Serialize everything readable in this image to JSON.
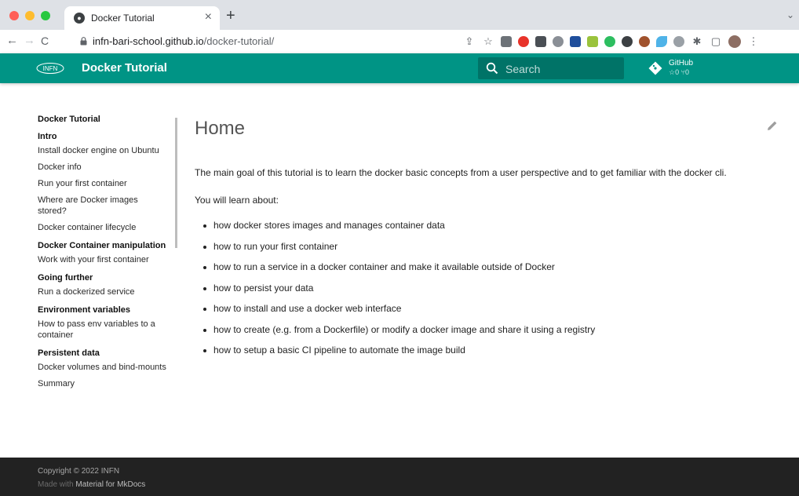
{
  "browser": {
    "tab_title": "Docker Tutorial",
    "tab_close": "×",
    "new_tab": "+",
    "tabs_menu": "⌄",
    "nav": {
      "back": "←",
      "forward": "→",
      "reload": "C"
    },
    "url_host": "infn-bari-school.github.io",
    "url_path": "/docker-tutorial/",
    "toolbar_icons": [
      "share-icon",
      "bookmark-star-icon",
      "extension-icons",
      "puzzle-icon",
      "sidebar-icon",
      "profile-avatar",
      "menu-icon"
    ],
    "toolbar_glyphs": {
      "share": "⇪",
      "star": "☆",
      "puzzle": "✱",
      "sidebar": "▢",
      "menu": "⋮"
    }
  },
  "header": {
    "title": "Docker Tutorial",
    "logo_text": "INFN",
    "search_placeholder": "Search",
    "repo_name": "GitHub",
    "repo_facts": "☆0 ⑂0",
    "accent_color": "#009485"
  },
  "sidebar": {
    "title": "Docker Tutorial",
    "sections": [
      {
        "label": "Intro",
        "items": [
          "Install docker engine on Ubuntu",
          "Docker info",
          "Run your first container",
          "Where are Docker images stored?",
          "Docker container lifecycle"
        ]
      },
      {
        "label": "Docker Container manipulation",
        "items": [
          "Work with your first container"
        ]
      },
      {
        "label": "Going further",
        "items": [
          "Run a dockerized service"
        ]
      },
      {
        "label": "Environment variables",
        "items": [
          "How to pass env variables to a container"
        ]
      },
      {
        "label": "Persistent data",
        "items": [
          "Docker volumes and bind-mounts",
          "Summary"
        ]
      }
    ]
  },
  "content": {
    "title": "Home",
    "intro": "The main goal of this tutorial is to learn the docker basic concepts from a user perspective and to get familiar with the docker cli.",
    "learn_heading": "You will learn about:",
    "bullets": [
      "how docker stores images and manages container data",
      "how to run your first container",
      "how to run a service in a docker container and make it available outside of Docker",
      "how to persist your data",
      "how to install and use a docker web interface",
      "how to create (e.g. from a Dockerfile) or modify a docker image and share it using a registry",
      "how to setup a basic CI pipeline to automate the image build"
    ]
  },
  "footer": {
    "copyright": "Copyright © 2022 INFN",
    "made_with_prefix": "Made with ",
    "made_with_link": "Material for MkDocs"
  }
}
